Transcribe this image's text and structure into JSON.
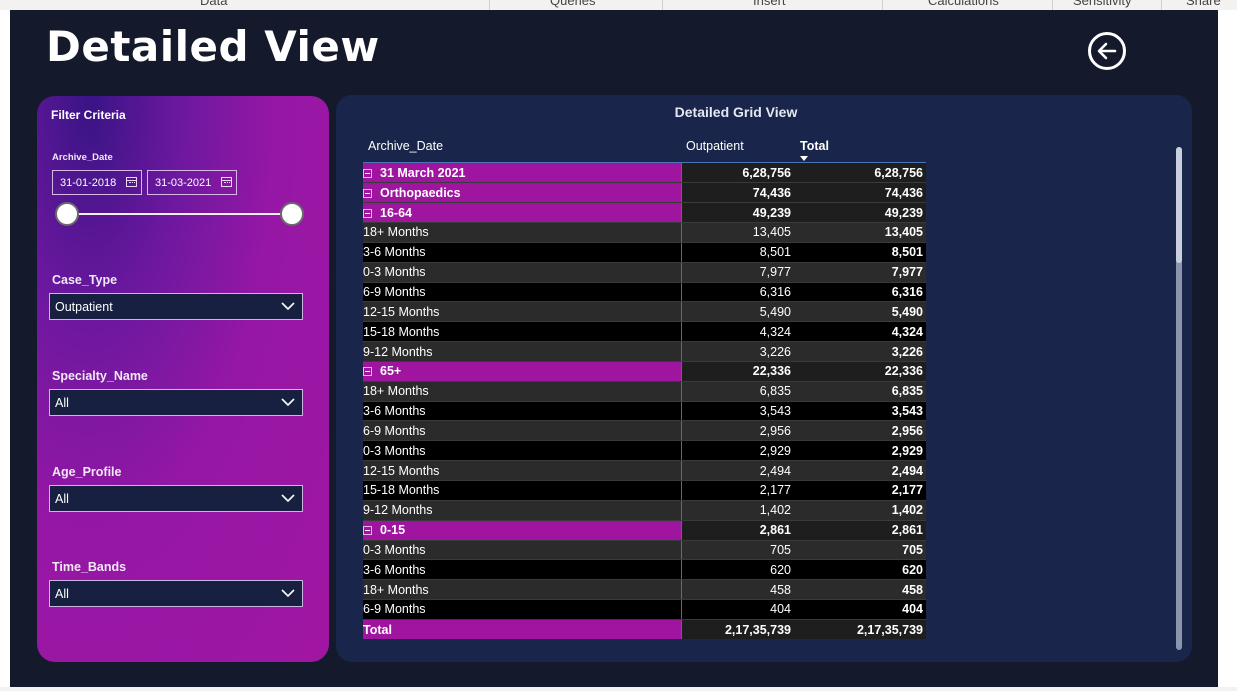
{
  "ribbon": {
    "tabs": [
      "Data",
      "Queries",
      "Insert",
      "Calculations",
      "Sensitivity",
      "Share"
    ]
  },
  "page": {
    "title": "Detailed View"
  },
  "back_button": {
    "icon": "arrow-left-circle-icon"
  },
  "filters": {
    "title": "Filter Criteria",
    "archive_date": {
      "label": "Archive_Date",
      "start": "31-01-2018",
      "end": "31-03-2021",
      "range_fraction": [
        0.0,
        1.0
      ]
    },
    "case_type": {
      "label": "Case_Type",
      "value": "Outpatient"
    },
    "specialty_name": {
      "label": "Specialty_Name",
      "value": "All"
    },
    "age_profile": {
      "label": "Age_Profile",
      "value": "All"
    },
    "time_bands": {
      "label": "Time_Bands",
      "value": "All"
    }
  },
  "grid": {
    "title": "Detailed Grid View",
    "headers": [
      "Archive_Date",
      "Outpatient",
      "Total"
    ],
    "rows": [
      {
        "level": 0,
        "group": true,
        "label": "31 March 2021",
        "outpatient": "6,28,756",
        "total": "6,28,756"
      },
      {
        "level": 1,
        "group": true,
        "label": "Orthopaedics",
        "outpatient": "74,436",
        "total": "74,436"
      },
      {
        "level": 2,
        "group": true,
        "label": "16-64",
        "outpatient": "49,239",
        "total": "49,239"
      },
      {
        "level": 3,
        "group": false,
        "label": "18+ Months",
        "outpatient": "13,405",
        "total": "13,405"
      },
      {
        "level": 3,
        "group": false,
        "label": "3-6 Months",
        "outpatient": "8,501",
        "total": "8,501"
      },
      {
        "level": 3,
        "group": false,
        "label": "0-3 Months",
        "outpatient": "7,977",
        "total": "7,977"
      },
      {
        "level": 3,
        "group": false,
        "label": "6-9 Months",
        "outpatient": "6,316",
        "total": "6,316"
      },
      {
        "level": 3,
        "group": false,
        "label": "12-15 Months",
        "outpatient": "5,490",
        "total": "5,490"
      },
      {
        "level": 3,
        "group": false,
        "label": "15-18 Months",
        "outpatient": "4,324",
        "total": "4,324"
      },
      {
        "level": 3,
        "group": false,
        "label": "9-12 Months",
        "outpatient": "3,226",
        "total": "3,226"
      },
      {
        "level": 2,
        "group": true,
        "label": "65+",
        "outpatient": "22,336",
        "total": "22,336"
      },
      {
        "level": 3,
        "group": false,
        "label": "18+ Months",
        "outpatient": "6,835",
        "total": "6,835"
      },
      {
        "level": 3,
        "group": false,
        "label": "3-6 Months",
        "outpatient": "3,543",
        "total": "3,543"
      },
      {
        "level": 3,
        "group": false,
        "label": "6-9 Months",
        "outpatient": "2,956",
        "total": "2,956"
      },
      {
        "level": 3,
        "group": false,
        "label": "0-3 Months",
        "outpatient": "2,929",
        "total": "2,929"
      },
      {
        "level": 3,
        "group": false,
        "label": "12-15 Months",
        "outpatient": "2,494",
        "total": "2,494"
      },
      {
        "level": 3,
        "group": false,
        "label": "15-18 Months",
        "outpatient": "2,177",
        "total": "2,177"
      },
      {
        "level": 3,
        "group": false,
        "label": "9-12 Months",
        "outpatient": "1,402",
        "total": "1,402"
      },
      {
        "level": 2,
        "group": true,
        "label": "0-15",
        "outpatient": "2,861",
        "total": "2,861"
      },
      {
        "level": 3,
        "group": false,
        "label": "0-3 Months",
        "outpatient": "705",
        "total": "705"
      },
      {
        "level": 3,
        "group": false,
        "label": "3-6 Months",
        "outpatient": "620",
        "total": "620"
      },
      {
        "level": 3,
        "group": false,
        "label": "18+ Months",
        "outpatient": "458",
        "total": "458"
      },
      {
        "level": 3,
        "group": false,
        "label": "6-9 Months",
        "outpatient": "404",
        "total": "404"
      }
    ],
    "total_row": {
      "label": "Total",
      "outpatient": "2,17,35,739",
      "total": "2,17,35,739"
    }
  },
  "colors": {
    "canvas": "#141a2b",
    "group_highlight": "#a015a0",
    "grid_panel": "#19254a",
    "dropdown_bg": "#172040"
  }
}
